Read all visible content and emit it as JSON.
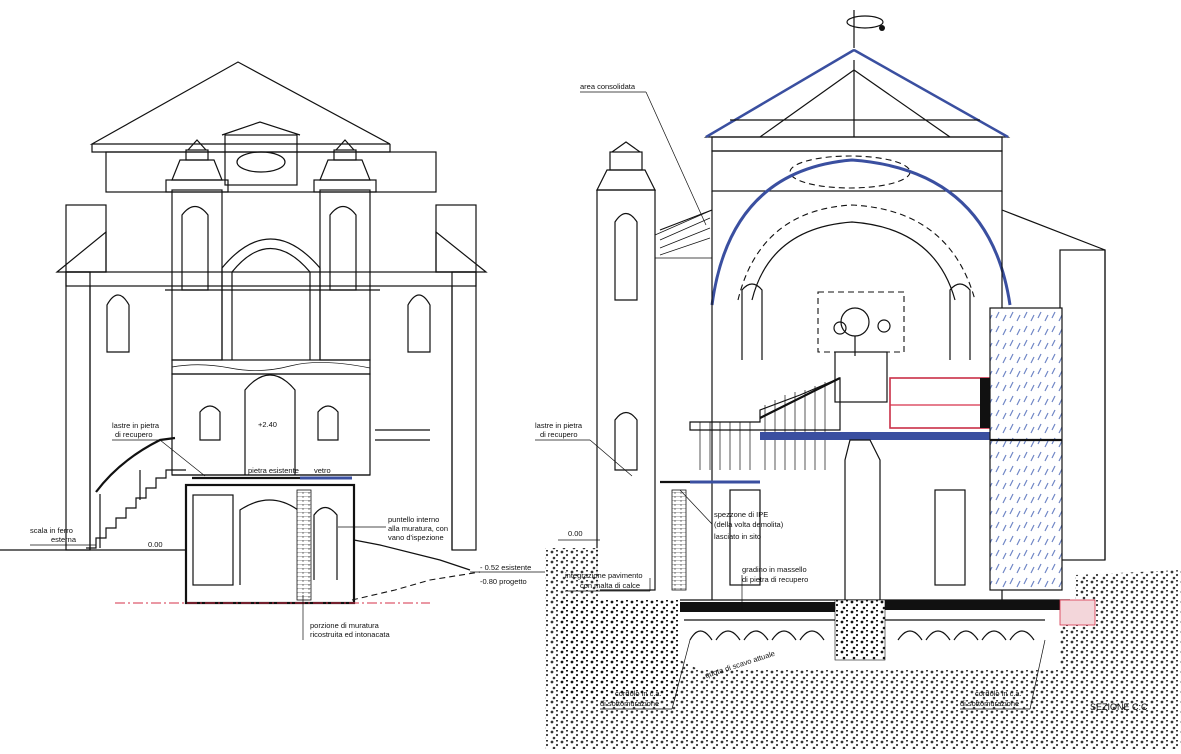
{
  "drawing": {
    "title": "SEZIONE C:C",
    "colors": {
      "line": "#111111",
      "steel_blue": "#3a4fa0",
      "glass_blue": "#6f86c6",
      "section_red": "#d6304a",
      "ground": "#222222"
    }
  },
  "left_labels": {
    "lastre": [
      "lastre in pietra",
      "di recupero"
    ],
    "scala": [
      "scala in ferro",
      "esterna"
    ],
    "level_000": "0.00",
    "level_240": "+2.40",
    "pietra": "pietra esistente",
    "vetro": "vetro",
    "puntello": [
      "puntello interno",
      "alla muratura, con",
      "vano d'ispezione"
    ],
    "esistente": "- 0.52 esistente",
    "progetto": "-0.80 progetto",
    "porzione": [
      "porzione di muratura",
      "ricostruita ed intonacata"
    ]
  },
  "right_labels": {
    "area": "area consolidata",
    "lastre": [
      "lastre in pietra",
      "di recupero"
    ],
    "level_000": "0.00",
    "spezzone": [
      "spezzone di IPE",
      "(della volta demolita)",
      "lasciato in sito"
    ],
    "integrazione": [
      "integrazione pavimento",
      "con malta di calce"
    ],
    "gradino": [
      "gradino in massello",
      "di pietra di recupero"
    ],
    "quota": "quota di scavo attuale",
    "cordolo_left": [
      "cordolo in c.a.",
      "di sottomurazione"
    ],
    "cordolo_right": [
      "cordolo in c.a.",
      "di sottomurazione"
    ]
  }
}
